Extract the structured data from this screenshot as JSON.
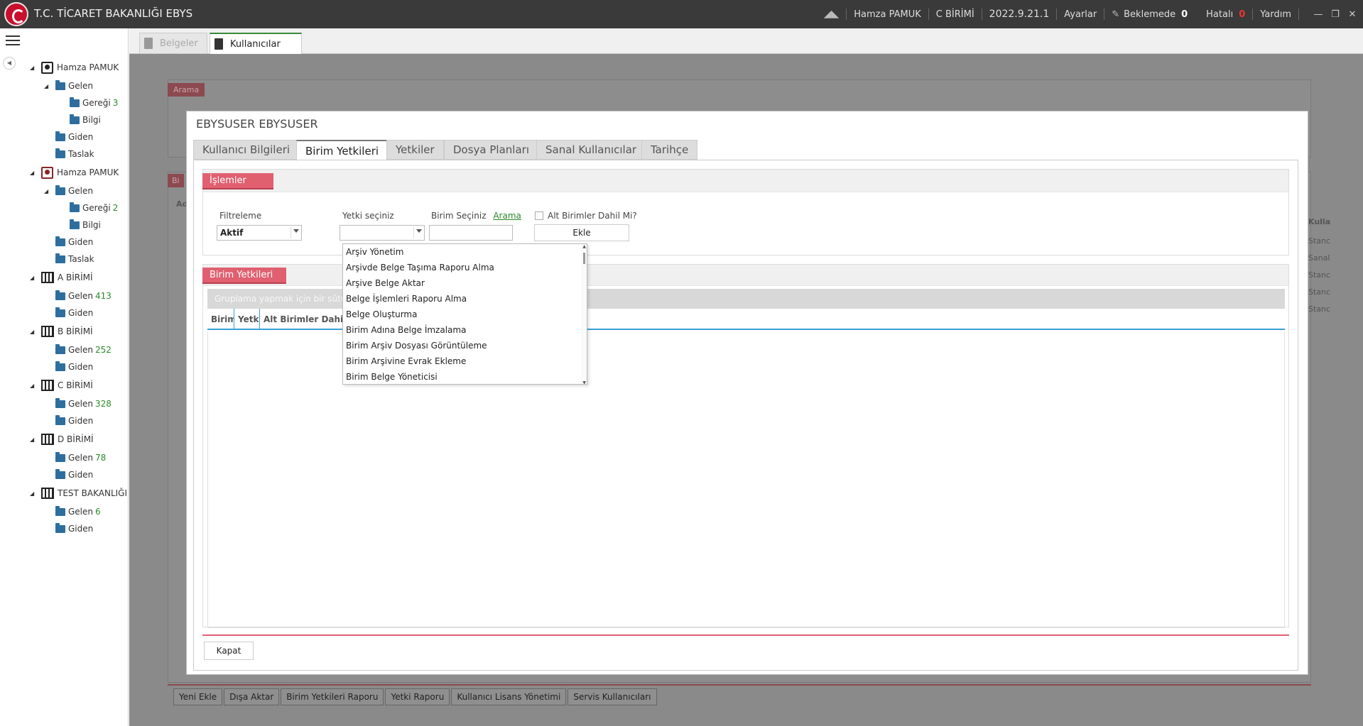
{
  "app": {
    "title": "T.C. TİCARET BAKANLIĞI EBYS"
  },
  "topbar": {
    "user": "Hamza PAMUK",
    "unit": "C BİRİMİ",
    "version": "2022.9.21.1",
    "settings": "Ayarlar",
    "pending_label": "Beklemede",
    "pending_count": "0",
    "error_label": "Hatalı",
    "error_count": "0",
    "help": "Yardım"
  },
  "sidebar": {
    "tree": [
      {
        "label": "Hamza PAMUK",
        "kind": "user"
      },
      {
        "label": "Gelen",
        "kind": "folder"
      },
      {
        "label": "Gereği",
        "kind": "folder",
        "count": "3"
      },
      {
        "label": "Bilgi",
        "kind": "folder"
      },
      {
        "label": "Giden",
        "kind": "folder"
      },
      {
        "label": "Taslak",
        "kind": "folder"
      },
      {
        "label": "Hamza PAMUK",
        "kind": "user"
      },
      {
        "label": "Gelen",
        "kind": "folder"
      },
      {
        "label": "Gereği",
        "kind": "folder",
        "count": "2"
      },
      {
        "label": "Bilgi",
        "kind": "folder"
      },
      {
        "label": "Giden",
        "kind": "folder"
      },
      {
        "label": "Taslak",
        "kind": "folder"
      },
      {
        "label": "A BİRİMİ",
        "kind": "building"
      },
      {
        "label": "Gelen",
        "kind": "folder",
        "count": "413"
      },
      {
        "label": "Giden",
        "kind": "folder"
      },
      {
        "label": "B BİRİMİ",
        "kind": "building"
      },
      {
        "label": "Gelen",
        "kind": "folder",
        "count": "252"
      },
      {
        "label": "Giden",
        "kind": "folder"
      },
      {
        "label": "C BİRİMİ",
        "kind": "building"
      },
      {
        "label": "Gelen",
        "kind": "folder",
        "count": "328"
      },
      {
        "label": "Giden",
        "kind": "folder"
      },
      {
        "label": "D BİRİMİ",
        "kind": "building"
      },
      {
        "label": "Gelen",
        "kind": "folder",
        "count": "78"
      },
      {
        "label": "Giden",
        "kind": "folder"
      },
      {
        "label": "TEST BAKANLIĞI",
        "kind": "building"
      },
      {
        "label": "Gelen",
        "kind": "folder",
        "count": "6"
      },
      {
        "label": "Giden",
        "kind": "folder"
      }
    ]
  },
  "main_tabs": [
    {
      "label": "Belgeler"
    },
    {
      "label": "Kullanıcılar"
    }
  ],
  "background": {
    "search_label": "Arama",
    "unit_label": "Bi",
    "col_fragment": "Ad",
    "right_col_header": "Kulla",
    "right_col_values": [
      "Stanc",
      "Sanal",
      "Stanc",
      "Stanc",
      "Stanc"
    ]
  },
  "bottom_buttons": [
    {
      "label": "Yeni Ekle"
    },
    {
      "label": "Dışa Aktar"
    },
    {
      "label": "Birim Yetkileri Raporu"
    },
    {
      "label": "Yetki Raporu"
    },
    {
      "label": "Kullanıcı Lisans Yönetimi"
    },
    {
      "label": "Servis Kullanıcıları"
    }
  ],
  "modal": {
    "title": "EBYSUSER EBYSUSER",
    "tabs": [
      {
        "label": "Kullanıcı Bilgileri"
      },
      {
        "label": "Birim Yetkileri"
      },
      {
        "label": "Yetkiler"
      },
      {
        "label": "Dosya Planları"
      },
      {
        "label": "Sanal Kullanıcılar"
      },
      {
        "label": "Tarihçe"
      }
    ],
    "operations": {
      "title": "İşlemler",
      "filter_label": "Filtreleme",
      "filter_value": "Aktif",
      "permission_label": "Yetki seçiniz",
      "permission_value": "",
      "unit_label": "Birim Seçiniz",
      "search_link": "Arama",
      "unit_value": "",
      "include_sub_label": "Alt Birimler Dahil Mi?",
      "add_button": "Ekle"
    },
    "unit_permissions": {
      "title": "Birim Yetkileri",
      "group_hint": "Gruplama yapmak için bir sütun b",
      "columns": [
        "Birim",
        "Yetki",
        "Alt Birimler Dahil M"
      ]
    },
    "close_button": "Kapat"
  },
  "dropdown": {
    "options": [
      "Arşiv Yönetim",
      "Arşivde Belge Taşıma Raporu Alma",
      "Arşive Belge Aktar",
      "Belge İşlemleri Raporu Alma",
      "Belge Oluşturma",
      "Birim Adına Belge İmzalama",
      "Birim Arşiv Dosyası Görüntüleme",
      "Birim Arşivine Evrak Ekleme",
      "Birim Belge Yöneticisi"
    ]
  }
}
